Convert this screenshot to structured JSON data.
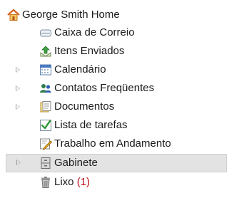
{
  "tree": {
    "root": {
      "label": "George Smith Home",
      "icon": "home-icon"
    },
    "items": [
      {
        "label": "Caixa de Correio",
        "icon": "mailbox-icon",
        "expandable": false
      },
      {
        "label": "Itens Enviados",
        "icon": "sent-items-icon",
        "expandable": false
      },
      {
        "label": "Calendário",
        "icon": "calendar-icon",
        "expandable": true
      },
      {
        "label": "Contatos Freqüentes",
        "icon": "contacts-icon",
        "expandable": true
      },
      {
        "label": "Documentos",
        "icon": "documents-icon",
        "expandable": true
      },
      {
        "label": "Lista de tarefas",
        "icon": "task-list-icon",
        "expandable": false
      },
      {
        "label": "Trabalho em Andamento",
        "icon": "work-in-progress-icon",
        "expandable": false
      },
      {
        "label": "Gabinete",
        "icon": "cabinet-icon",
        "expandable": true,
        "selected": true
      },
      {
        "label": "Lixo",
        "count": "(1)",
        "icon": "trash-icon",
        "expandable": false
      }
    ]
  },
  "colors": {
    "selection_background": "#e3e3e3",
    "count_text": "#c0121a",
    "expander_arrow": "#9a9a9a"
  }
}
